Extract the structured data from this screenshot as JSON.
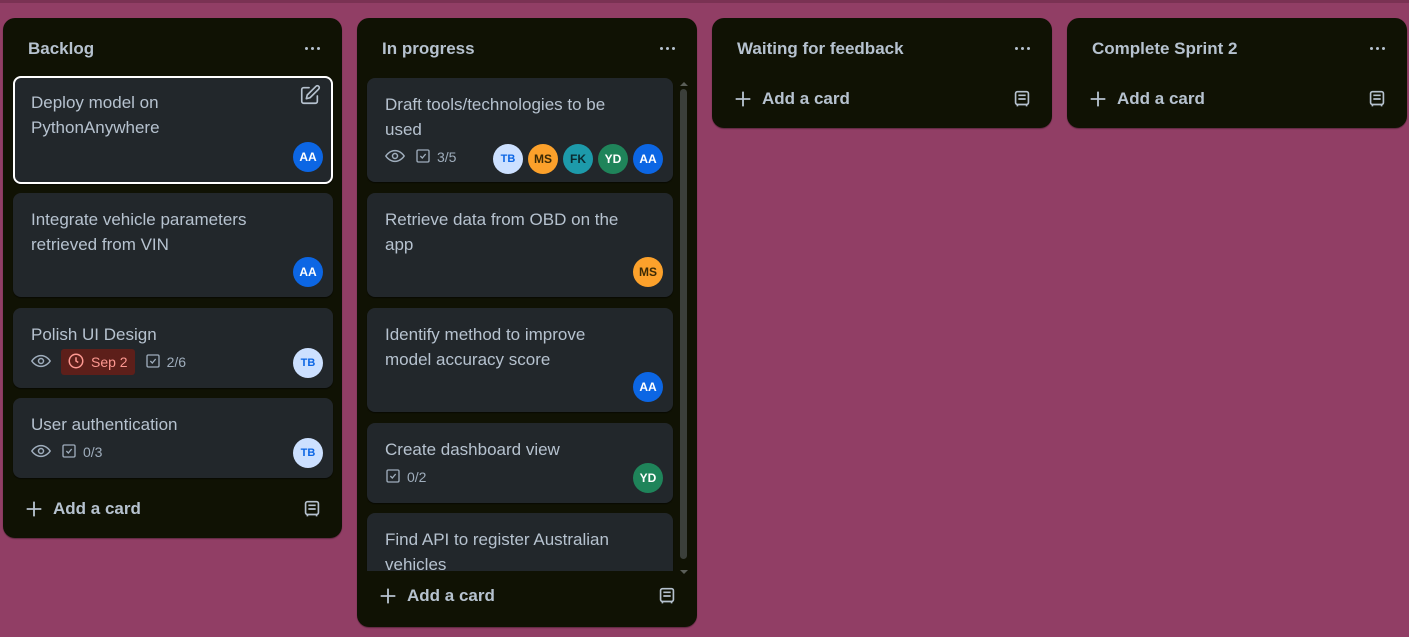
{
  "colors": {
    "board_background": "#913e65",
    "list_background": "#101204",
    "card_background": "#22272b",
    "text": "#b6c2cf",
    "due_overdue_bg": "#5d1f1a",
    "due_overdue_text": "#fd9891"
  },
  "lists": [
    {
      "title": "Backlog",
      "cards": [
        {
          "title": "Deploy model on PythonAnywhere",
          "members": [
            "AA"
          ],
          "edit_icon": "pencil-icon"
        },
        {
          "title": "Integrate vehicle parameters retrieved from VIN",
          "members": [
            "AA"
          ]
        },
        {
          "title": "Polish UI Design",
          "watch_icon": "eye-icon",
          "due": "Sep 2",
          "checklist": "2/6",
          "members": [
            "TB"
          ]
        },
        {
          "title": "User authentication",
          "watch_icon": "eye-icon",
          "checklist": "0/3",
          "members": [
            "TB"
          ]
        }
      ],
      "add_card_label": "Add a card"
    },
    {
      "title": "In progress",
      "cards": [
        {
          "title": "Draft tools/technologies to be used",
          "watch_icon": "eye-icon",
          "checklist": "3/5",
          "members": [
            "TB",
            "MS",
            "FK",
            "YD",
            "AA"
          ]
        },
        {
          "title": "Retrieve data from OBD on the app",
          "members": [
            "MS"
          ]
        },
        {
          "title": "Identify method to improve model accuracy score",
          "members": [
            "AA"
          ]
        },
        {
          "title": "Create dashboard view",
          "checklist": "0/2",
          "members": [
            "YD"
          ]
        },
        {
          "title": "Find API to register Australian vehicles"
        }
      ],
      "add_card_label": "Add a card"
    },
    {
      "title": "Waiting for feedback",
      "cards": [],
      "add_card_label": "Add a card"
    },
    {
      "title": "Complete Sprint 2",
      "cards": [],
      "add_card_label": "Add a card"
    }
  ],
  "avatars": {
    "AA": {
      "label": "AA",
      "bg": "#0c66e4",
      "fg": "#ffffff"
    },
    "TB": {
      "label": "TB",
      "bg": "#cce0ff",
      "fg": "#0c66e4"
    },
    "MS": {
      "label": "MS",
      "bg": "#fca12b",
      "fg": "#3b2a05"
    },
    "FK": {
      "label": "FK",
      "bg": "#1d9aaa",
      "fg": "#0a2b30"
    },
    "YD": {
      "label": "YD",
      "bg": "#1f845a",
      "fg": "#ffffff"
    }
  }
}
